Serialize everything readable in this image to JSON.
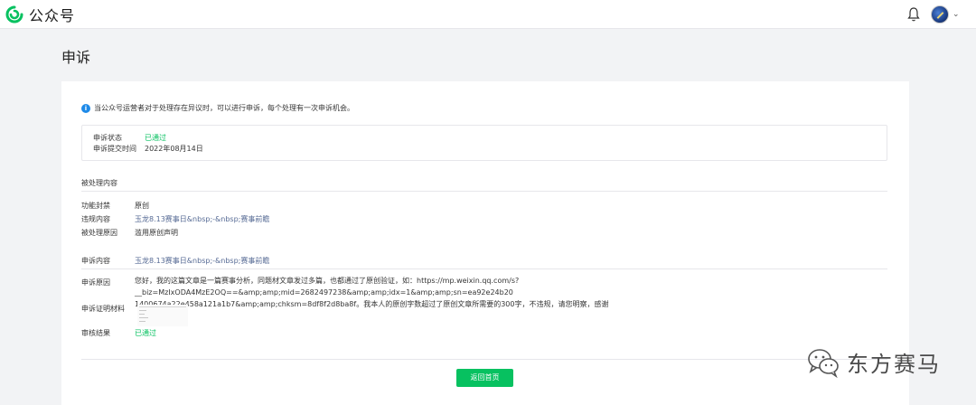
{
  "header": {
    "app_name": "公众号",
    "logo_icon": "wechat-official-account-logo",
    "bell_icon": "bell-icon",
    "avatar_icon": "avatar",
    "caret": "⌄"
  },
  "page": {
    "title": "申诉"
  },
  "notice": {
    "icon": "info-icon",
    "text": "当公众号运营者对于处理存在异议时，可以进行申诉，每个处理有一次申诉机会。"
  },
  "status": {
    "state_label": "申诉状态",
    "state_value": "已通过",
    "time_label": "申诉提交时间",
    "time_value": "2022年08月14日"
  },
  "handled": {
    "section_title": "被处理内容",
    "rows": [
      {
        "label": "功能封禁",
        "value": "原创"
      },
      {
        "label": "违规内容",
        "value": "玉龙8.13赛事日&nbsp;-&nbsp;赛事前瞻"
      },
      {
        "label": "被处理原因",
        "value": "滥用原创声明"
      }
    ]
  },
  "appeal": {
    "content_label": "申诉内容",
    "content_value": "玉龙8.13赛事日&nbsp;-&nbsp;赛事前瞻",
    "reason_label": "申诉原因",
    "reason_line1": "您好，我的这篇文章是一篇赛事分析，同题材文章发过多篇，也都通过了原创验证，如：https://mp.weixin.qq.com/s?__biz=MzIxODA4MzE2OQ==&amp;amp;mid=2682497238&amp;amp;idx=1&amp;amp;sn=ea92e24b20",
    "reason_line2": "1400674a22e458a121a1b7&amp;amp;chksm=8df8f2d8ba8f。我本人的原创字数超过了原创文章所需要的300字，不违规，请您明察，感谢",
    "proof_label": "申诉证明材料",
    "result_label": "审核结果",
    "result_value": "已通过"
  },
  "actions": {
    "back_home": "返回首页"
  },
  "watermark": {
    "text": "东方赛马",
    "icon": "wechat-bubble-icon"
  },
  "colors": {
    "accent": "#07c160",
    "link": "#576b95",
    "info": "#1e8ae8"
  }
}
